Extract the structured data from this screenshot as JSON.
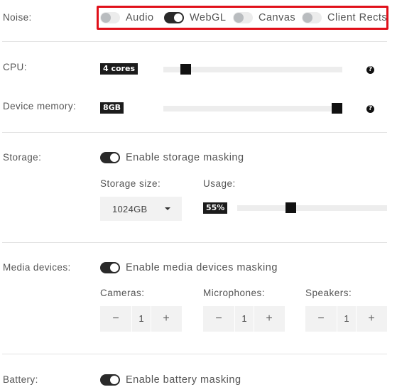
{
  "noise": {
    "label": "Noise:",
    "toggles": [
      {
        "label": "Audio",
        "on": false
      },
      {
        "label": "WebGL",
        "on": true
      },
      {
        "label": "Canvas",
        "on": false
      },
      {
        "label": "Client Rects",
        "on": false
      }
    ]
  },
  "cpu": {
    "label": "CPU:",
    "value_text": "4 cores",
    "level": 0.08,
    "help_icon": "?"
  },
  "device_memory": {
    "label": "Device memory:",
    "value_text": "8GB",
    "level": 1.0,
    "help_icon": "?"
  },
  "storage": {
    "label": "Storage:",
    "toggle_label": "Enable storage masking",
    "toggle_on": true,
    "size_label": "Storage size:",
    "size_value": "1024GB",
    "usage_label": "Usage:",
    "usage_value": "55%",
    "usage_level": 0.55
  },
  "media_devices": {
    "label": "Media devices:",
    "toggle_label": "Enable media devices masking",
    "toggle_on": true,
    "cameras": {
      "label": "Cameras:",
      "value": "1"
    },
    "microphones": {
      "label": "Microphones:",
      "value": "1"
    },
    "speakers": {
      "label": "Speakers:",
      "value": "1"
    },
    "minus_symbol": "−",
    "plus_symbol": "+"
  },
  "battery": {
    "label": "Battery:",
    "toggle_label": "Enable battery masking",
    "toggle_on": true
  }
}
